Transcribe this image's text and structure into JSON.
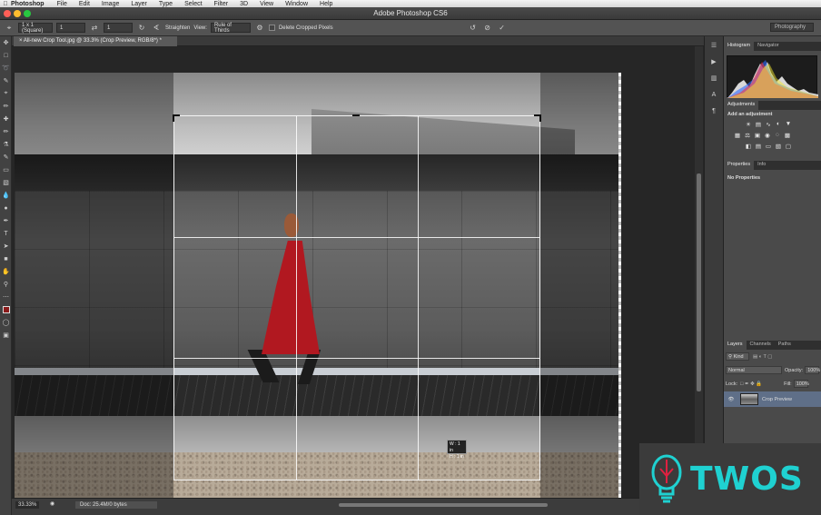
{
  "menubar": {
    "app": "Photoshop",
    "items": [
      "File",
      "Edit",
      "Image",
      "Layer",
      "Type",
      "Select",
      "Filter",
      "3D",
      "View",
      "Window",
      "Help"
    ]
  },
  "window": {
    "title": "Adobe Photoshop CS6"
  },
  "options": {
    "preset": "1 x 1 (Square)",
    "width": "1",
    "height": "1",
    "straighten": "Straighten",
    "view_label": "View:",
    "view_value": "Rule of Thirds",
    "delete_cropped": "Delete Cropped Pixels",
    "workspace": "Photography"
  },
  "document": {
    "tab_title": "All-new Crop Tool.jpg @ 33.3% (Crop Preview, RGB/8*) *",
    "crop_info_w": "W : 1 in",
    "crop_info_h": "H : 1 in"
  },
  "status": {
    "zoom": "33.33%",
    "doc": "Doc: 25.4M/0 bytes"
  },
  "panels": {
    "histogram_tab": "Histogram",
    "navigator_tab": "Navigator",
    "adjustments_tab": "Adjustments",
    "add_adjustment": "Add an adjustment",
    "properties_tab": "Properties",
    "info_tab": "Info",
    "no_properties": "No Properties",
    "layers_tab": "Layers",
    "channels_tab": "Channels",
    "paths_tab": "Paths",
    "kind": "Kind",
    "blend_mode": "Normal",
    "opacity_label": "Opacity:",
    "opacity_value": "100%",
    "lock_label": "Lock:",
    "fill_label": "Fill:",
    "fill_value": "100%",
    "layer_name": "Crop Preview"
  },
  "watermark": {
    "text": "TWOS"
  },
  "colors": {
    "accent": "#1fd1d1",
    "dress": "#b11820"
  }
}
